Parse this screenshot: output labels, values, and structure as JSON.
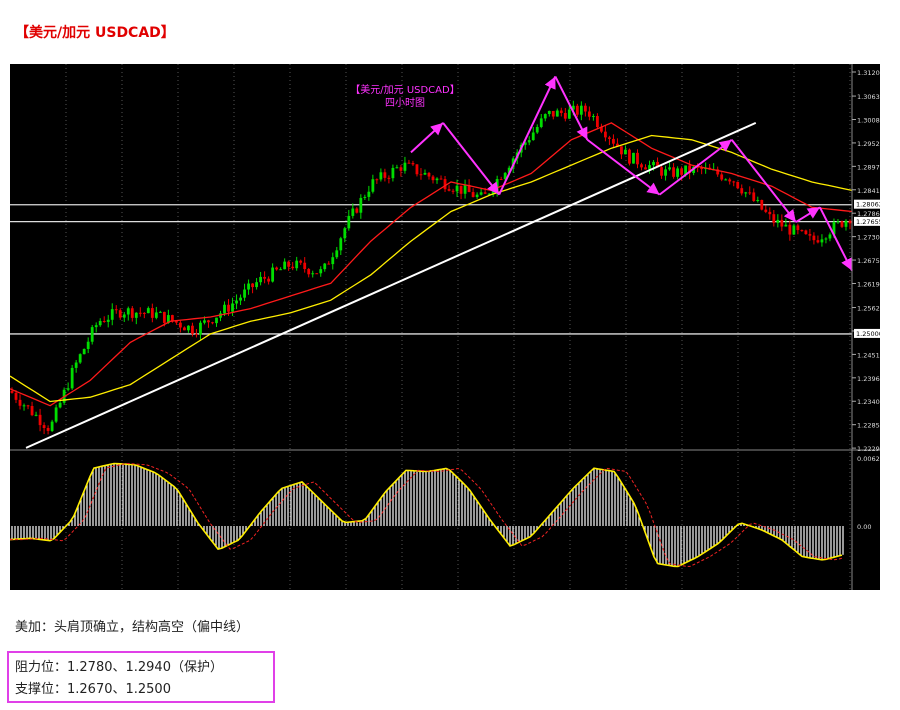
{
  "heading": "【美元/加元 USDCAD】",
  "comment": "美加：头肩顶确立，结构高空（偏中线）",
  "levels": {
    "resistance": "阻力位：1.2780、1.2940（保护）",
    "support": "支撑位：1.2670、1.2500"
  },
  "chart_data": {
    "type": "line",
    "title_line1": "【美元/加元 USDCAD】",
    "title_line2": "四小时图",
    "price_ticks": [
      "1.31205",
      "1.30635",
      "1.30080",
      "1.29525",
      "1.28970",
      "1.28415",
      "1.27860",
      "1.27305",
      "1.26750",
      "1.26195",
      "1.25625",
      "1.25070",
      "1.24515",
      "1.23960",
      "1.23405",
      "1.22850",
      "1.22295"
    ],
    "price_highlight_labels": [
      "1.28062",
      "1.27655",
      "1.25000"
    ],
    "osc_ticks": [
      "0.00622",
      "0.00"
    ],
    "horizontal_levels": [
      1.2806,
      1.2766,
      1.25
    ],
    "trendline": [
      [
        4,
        1.223
      ],
      [
        186,
        1.3
      ]
    ],
    "ylim": [
      1.2225,
      1.313
    ],
    "candles_count": 210,
    "colors": {
      "background": "#000000",
      "up_candle": "#00dd00",
      "down_candle": "#ee0000",
      "fast_ma": "#ff1a1a",
      "slow_ma": "#ffee00",
      "trendline": "#ffffff",
      "pattern_arrows": "#ff33ff",
      "osc_bars": "#ffffff",
      "osc_signal": "#ffee00"
    },
    "series": [
      {
        "x": [
          0,
          10,
          16,
          22,
          28,
          36,
          46,
          54,
          62,
          70,
          78,
          84,
          90,
          98,
          108,
          118,
          126,
          134,
          144,
          154,
          164,
          172,
          180,
          190,
          200,
          210
        ],
        "values": [
          1.2365,
          1.2275,
          1.242,
          1.253,
          1.2555,
          1.2548,
          1.251,
          1.256,
          1.2625,
          1.2665,
          1.2645,
          1.276,
          1.2855,
          1.29,
          1.286,
          1.282,
          1.2925,
          1.302,
          1.303,
          1.292,
          1.288,
          1.289,
          1.287,
          1.277,
          1.272,
          1.278
        ]
      },
      {
        "x": [
          0,
          10,
          20,
          30,
          40,
          50,
          60,
          70,
          80,
          90,
          100,
          110,
          120,
          130,
          140,
          150,
          160,
          170,
          180,
          190,
          200,
          210
        ],
        "values": [
          1.237,
          1.233,
          1.239,
          1.248,
          1.253,
          1.254,
          1.256,
          1.259,
          1.262,
          1.272,
          1.28,
          1.286,
          1.284,
          1.288,
          1.296,
          1.3,
          1.294,
          1.29,
          1.288,
          1.285,
          1.28,
          1.279
        ]
      },
      {
        "x": [
          0,
          10,
          20,
          30,
          40,
          50,
          60,
          70,
          80,
          90,
          100,
          110,
          120,
          130,
          140,
          150,
          160,
          170,
          180,
          190,
          200,
          210
        ],
        "values": [
          1.24,
          1.234,
          1.235,
          1.238,
          1.244,
          1.25,
          1.253,
          1.255,
          1.258,
          1.264,
          1.272,
          1.279,
          1.283,
          1.286,
          1.29,
          1.294,
          1.297,
          1.296,
          1.293,
          1.289,
          1.286,
          1.284
        ]
      }
    ],
    "pattern_zigzags": [
      [
        [
          100,
          1.293
        ],
        [
          108,
          1.3
        ],
        [
          122,
          1.283
        ],
        [
          136,
          1.311
        ],
        [
          144,
          1.296
        ],
        [
          162,
          1.283
        ],
        [
          180,
          1.296
        ],
        [
          196,
          1.2765
        ],
        [
          202,
          1.28
        ],
        [
          210,
          1.265
        ]
      ]
    ],
    "osc_values": [
      -0.2,
      -0.18,
      -0.22,
      0.1,
      0.85,
      0.92,
      0.9,
      0.78,
      0.55,
      0.05,
      -0.35,
      -0.2,
      0.2,
      0.55,
      0.65,
      0.35,
      0.05,
      0.08,
      0.5,
      0.82,
      0.8,
      0.85,
      0.55,
      0.1,
      -0.3,
      -0.15,
      0.2,
      0.55,
      0.85,
      0.8,
      0.3,
      -0.55,
      -0.6,
      -0.45,
      -0.25,
      0.05,
      -0.05,
      -0.2,
      -0.45,
      -0.5,
      -0.42
    ]
  }
}
